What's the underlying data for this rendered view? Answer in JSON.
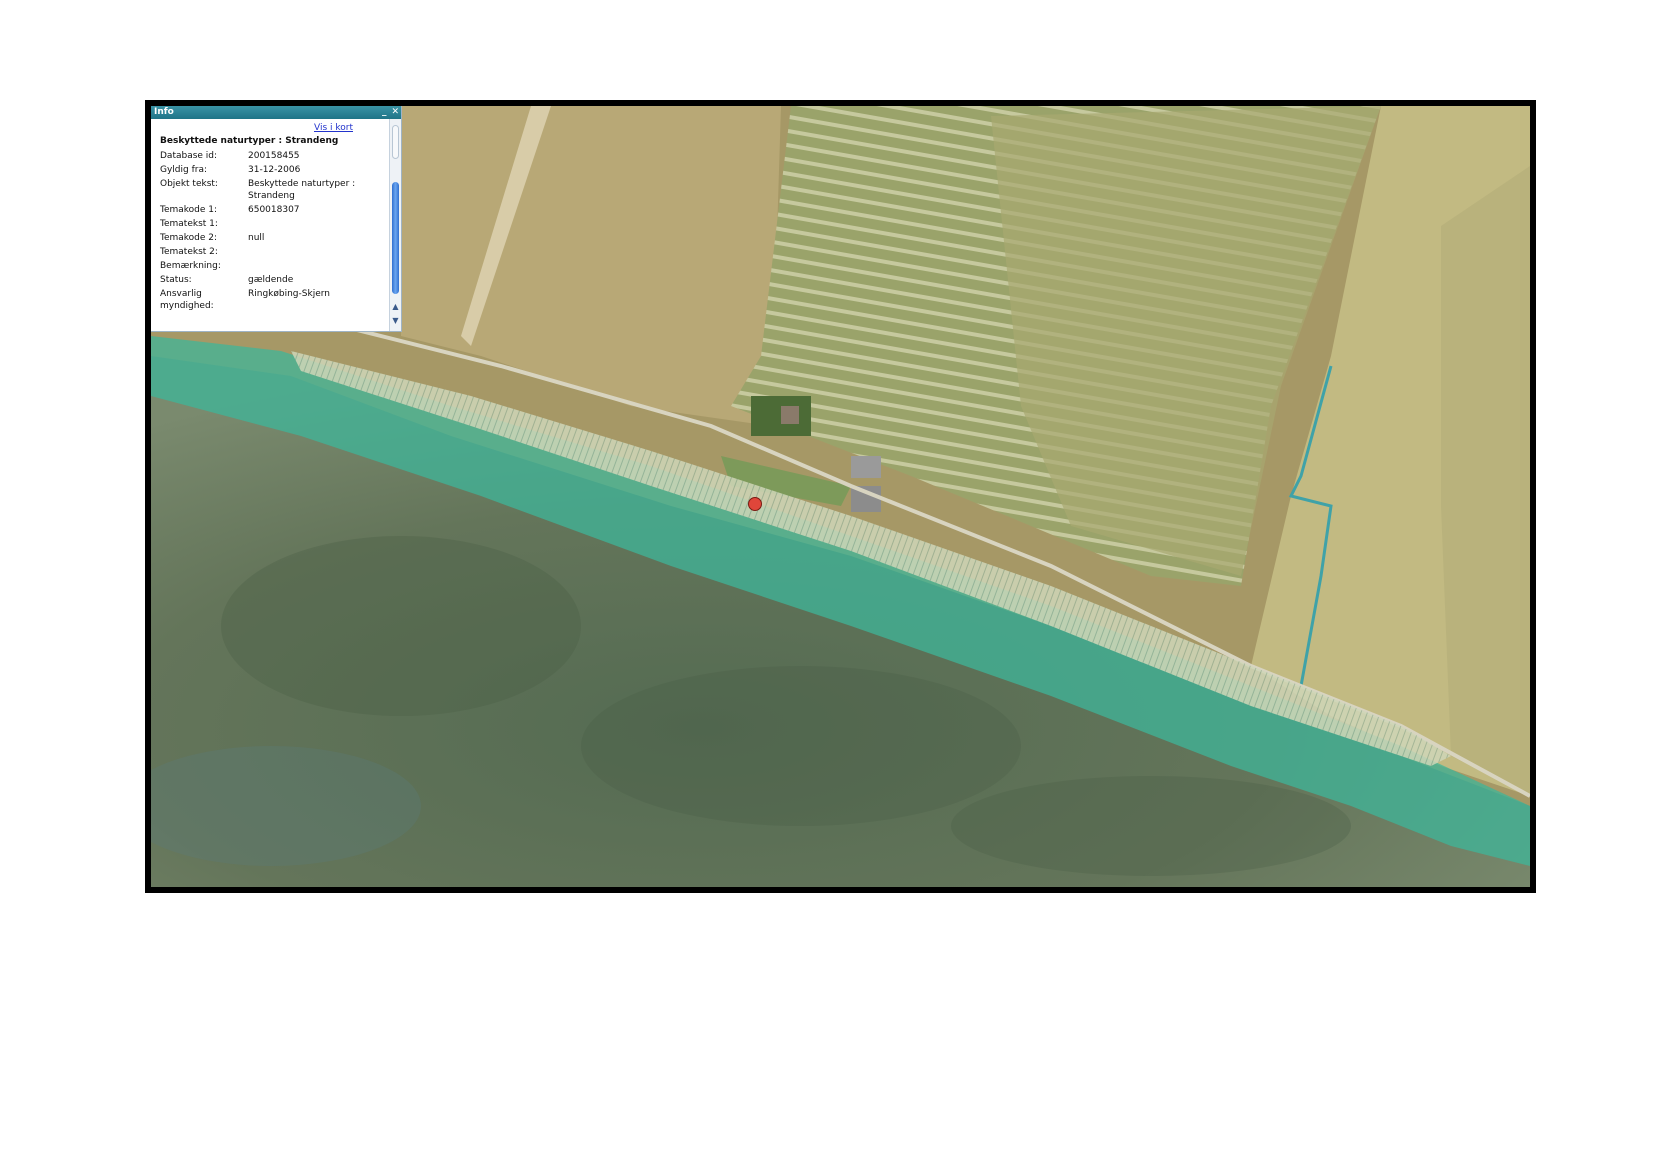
{
  "info_panel": {
    "title": "Info",
    "minimize_glyph": "_",
    "close_glyph": "✕",
    "link_label": "Vis i kort",
    "heading": "Beskyttede naturtyper : Strandeng",
    "rows": [
      {
        "key": "Database id:",
        "value": "200158455"
      },
      {
        "key": "Gyldig fra:",
        "value": "31-12-2006"
      },
      {
        "key": "Objekt tekst:",
        "value": "Beskyttede naturtyper : Strandeng"
      },
      {
        "key": "Temakode 1:",
        "value": "650018307"
      },
      {
        "key": "Tematekst 1:",
        "value": ""
      },
      {
        "key": "Temakode 2:",
        "value": "null"
      },
      {
        "key": "Tematekst 2:",
        "value": ""
      },
      {
        "key": "Bemærkning:",
        "value": ""
      },
      {
        "key": "Status:",
        "value": "gældende"
      },
      {
        "key": "Ansvarlig myndighed:",
        "value": "Ringkøbing-Skjern"
      }
    ],
    "scroll_up_icon": "▲",
    "scroll_down_icon": "▼"
  },
  "map": {
    "marker_color": "#e0463a",
    "water_color": "#5e6f52",
    "shore_overlay_color": "#3fb59a",
    "field_color": "#a89a62"
  }
}
